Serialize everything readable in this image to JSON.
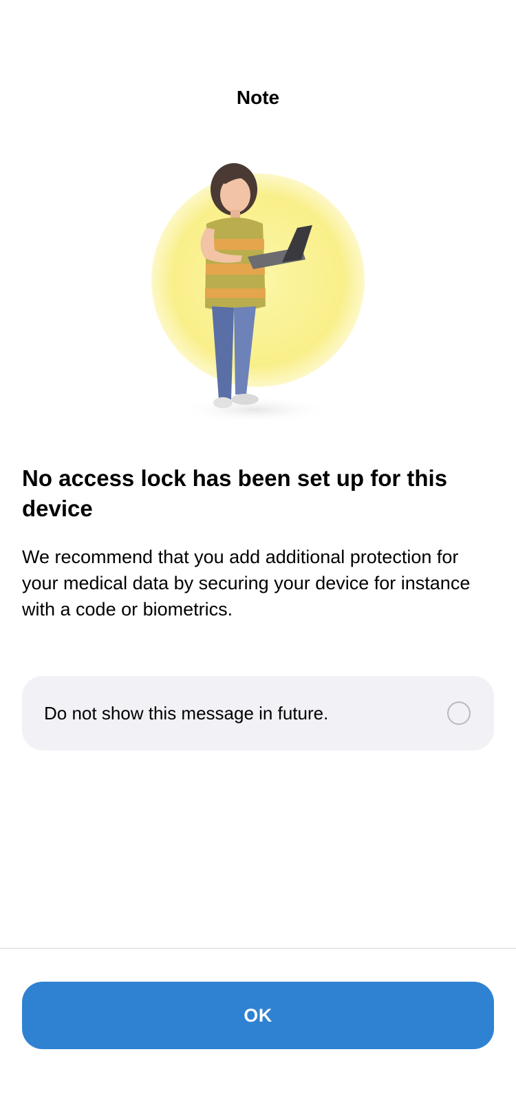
{
  "header": {
    "title": "Note"
  },
  "illustration": {
    "icon": "woman-with-laptop-illustration"
  },
  "message": {
    "headline": "No access lock has been set up for this device",
    "body": "We recommend that you add additional protection for your medical data by securing your device for instance with a code or biometrics."
  },
  "option": {
    "label": "Do not show this message in future.",
    "checked": false
  },
  "actions": {
    "ok_label": "OK"
  },
  "colors": {
    "accent": "#2F82D1",
    "card_background": "#F1F1F6",
    "circle": "#FBF39A"
  }
}
